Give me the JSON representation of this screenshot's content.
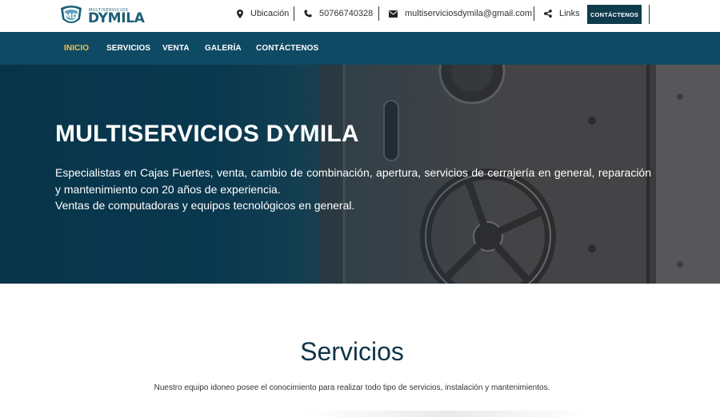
{
  "brand": {
    "small_text": "MULTISERVICIOS",
    "name": "DYMILA",
    "colors": {
      "primary": "#0e4a64",
      "dark": "#0f3c4c",
      "accent": "#f5c242"
    }
  },
  "topbar": {
    "location_icon": "map-pin-icon",
    "location": "Ubicación",
    "phone_icon": "phone-icon",
    "phone": "50766740328",
    "email_icon": "envelope-icon",
    "email": "multiserviciosdymila@gmail.com",
    "links_icon": "share-icon",
    "links": "Links",
    "cta": "CONTÁCTENOS"
  },
  "nav": {
    "items": [
      {
        "label": "INICIO",
        "active": true
      },
      {
        "label": "SERVICIOS",
        "active": false
      },
      {
        "label": "VENTA",
        "active": false
      },
      {
        "label": "GALERÍA",
        "active": false
      },
      {
        "label": "CONTÁCTENOS",
        "active": false
      }
    ]
  },
  "hero": {
    "title": "MULTISERVICIOS DYMILA",
    "line1": "Especialistas en Cajas Fuertes, venta, cambio de combinación, apertura, servicios de cerrajería en general, reparación y mantenimiento con 20 años de experiencia.",
    "line2": "Ventas de computadoras y equipos tecnológicos en general."
  },
  "services": {
    "title": "Servicios",
    "subtitle": "Nuestro equipo idoneo posee el conocimiento para realizar todo tipo de servicios, instalación y mantenimientos."
  }
}
